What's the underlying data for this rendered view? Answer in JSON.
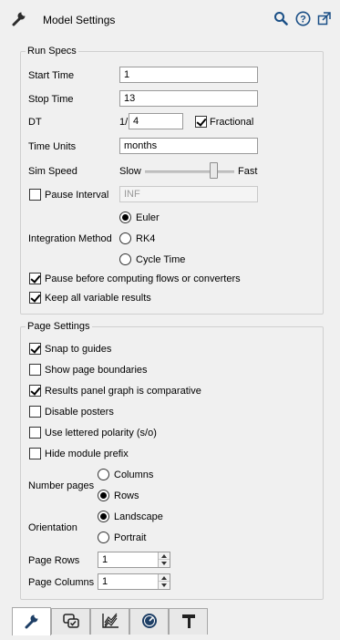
{
  "header": {
    "title": "Model Settings",
    "icons": [
      "wrench-icon",
      "search-icon",
      "help-icon",
      "popout-icon"
    ]
  },
  "run_specs": {
    "title": "Run Specs",
    "start_time": {
      "label": "Start Time",
      "value": "1"
    },
    "stop_time": {
      "label": "Stop Time",
      "value": "13"
    },
    "dt": {
      "label": "DT",
      "prefix": "1/",
      "value": "4",
      "fractional_label": "Fractional",
      "fractional_checked": true
    },
    "time_units": {
      "label": "Time Units",
      "value": "months"
    },
    "sim_speed": {
      "label": "Sim Speed",
      "slow": "Slow",
      "fast": "Fast",
      "level": 0.8
    },
    "pause_interval": {
      "label": "Pause Interval",
      "checked": false,
      "value": "INF"
    },
    "integration": {
      "label": "Integration Method",
      "options": [
        "Euler",
        "RK4",
        "Cycle Time"
      ],
      "selected": "Euler"
    },
    "pause_before": {
      "label": "Pause before computing flows or converters",
      "checked": true
    },
    "keep_all": {
      "label": "Keep all variable results",
      "checked": true
    }
  },
  "page_settings": {
    "title": "Page Settings",
    "snap": {
      "label": "Snap to guides",
      "checked": true
    },
    "show_bounds": {
      "label": "Show page boundaries",
      "checked": false
    },
    "results_panel": {
      "label": "Results panel graph is comparative",
      "checked": true
    },
    "disable_posters": {
      "label": "Disable posters",
      "checked": false
    },
    "lettered": {
      "label": "Use lettered polarity (s/o)",
      "checked": false
    },
    "hide_prefix": {
      "label": "Hide module prefix",
      "checked": false
    },
    "number_pages": {
      "label": "Number pages",
      "options": [
        "Columns",
        "Rows"
      ],
      "selected": "Rows"
    },
    "orientation": {
      "label": "Orientation",
      "options": [
        "Landscape",
        "Portrait"
      ],
      "selected": "Landscape"
    },
    "page_rows": {
      "label": "Page Rows",
      "value": "1"
    },
    "page_columns": {
      "label": "Page Columns",
      "value": "1"
    }
  },
  "tabs": [
    {
      "icon": "wrench-icon",
      "active": true
    },
    {
      "icon": "model-check-icon",
      "active": false
    },
    {
      "icon": "graph-icon",
      "active": false
    },
    {
      "icon": "gauge-icon",
      "active": false
    },
    {
      "icon": "paint-roller-icon",
      "active": false
    }
  ]
}
